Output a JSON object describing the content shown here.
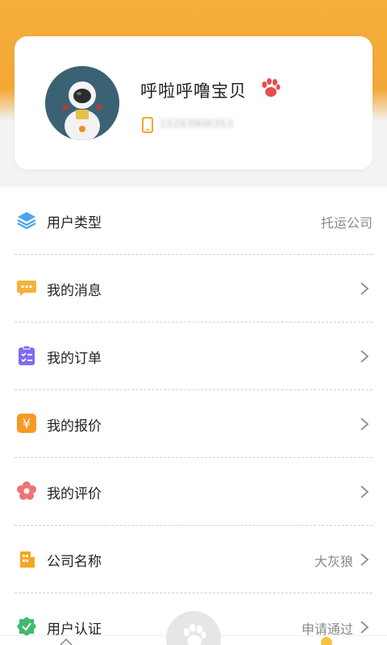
{
  "profile": {
    "nickname": "呼啦呼噜宝贝",
    "phone": "15263906353"
  },
  "menu": [
    {
      "icon": "layers-icon",
      "label": "用户类型",
      "value": "托运公司",
      "arrow": false,
      "color": "#4aa3ee"
    },
    {
      "icon": "chat-icon",
      "label": "我的消息",
      "value": "",
      "arrow": true,
      "color": "#f5b13c"
    },
    {
      "icon": "clipboard-icon",
      "label": "我的订单",
      "value": "",
      "arrow": true,
      "color": "#7d6cf2"
    },
    {
      "icon": "yuan-icon",
      "label": "我的报价",
      "value": "",
      "arrow": true,
      "color": "#f59a26"
    },
    {
      "icon": "flower-icon",
      "label": "我的评价",
      "value": "",
      "arrow": true,
      "color": "#f07373"
    },
    {
      "icon": "building-icon",
      "label": "公司名称",
      "value": "大灰狼",
      "arrow": true,
      "color": "#f5a623"
    },
    {
      "icon": "shield-check-icon",
      "label": "用户认证",
      "value": "申请通过",
      "arrow": true,
      "color": "#3dbb6e"
    }
  ],
  "colors": {
    "header": "#f6ae3c",
    "accent_paw": "#e84c4c"
  }
}
